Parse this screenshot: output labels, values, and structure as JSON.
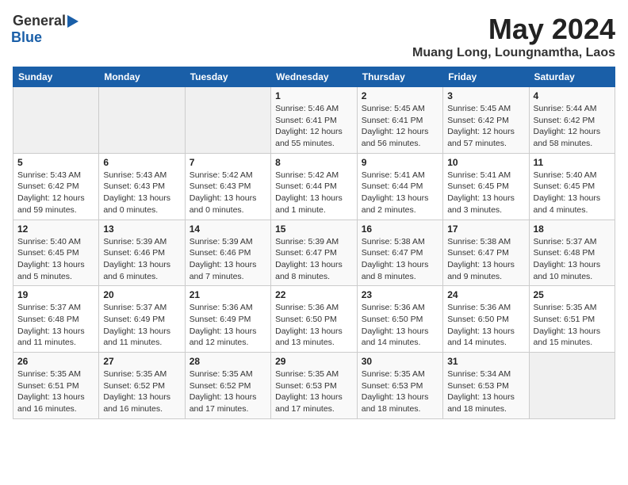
{
  "logo": {
    "general": "General",
    "blue": "Blue"
  },
  "title": "May 2024",
  "location": "Muang Long, Loungnamtha, Laos",
  "days_of_week": [
    "Sunday",
    "Monday",
    "Tuesday",
    "Wednesday",
    "Thursday",
    "Friday",
    "Saturday"
  ],
  "weeks": [
    [
      {
        "day": "",
        "info": ""
      },
      {
        "day": "",
        "info": ""
      },
      {
        "day": "",
        "info": ""
      },
      {
        "day": "1",
        "info": "Sunrise: 5:46 AM\nSunset: 6:41 PM\nDaylight: 12 hours\nand 55 minutes."
      },
      {
        "day": "2",
        "info": "Sunrise: 5:45 AM\nSunset: 6:41 PM\nDaylight: 12 hours\nand 56 minutes."
      },
      {
        "day": "3",
        "info": "Sunrise: 5:45 AM\nSunset: 6:42 PM\nDaylight: 12 hours\nand 57 minutes."
      },
      {
        "day": "4",
        "info": "Sunrise: 5:44 AM\nSunset: 6:42 PM\nDaylight: 12 hours\nand 58 minutes."
      }
    ],
    [
      {
        "day": "5",
        "info": "Sunrise: 5:43 AM\nSunset: 6:42 PM\nDaylight: 12 hours\nand 59 minutes."
      },
      {
        "day": "6",
        "info": "Sunrise: 5:43 AM\nSunset: 6:43 PM\nDaylight: 13 hours\nand 0 minutes."
      },
      {
        "day": "7",
        "info": "Sunrise: 5:42 AM\nSunset: 6:43 PM\nDaylight: 13 hours\nand 0 minutes."
      },
      {
        "day": "8",
        "info": "Sunrise: 5:42 AM\nSunset: 6:44 PM\nDaylight: 13 hours\nand 1 minute."
      },
      {
        "day": "9",
        "info": "Sunrise: 5:41 AM\nSunset: 6:44 PM\nDaylight: 13 hours\nand 2 minutes."
      },
      {
        "day": "10",
        "info": "Sunrise: 5:41 AM\nSunset: 6:45 PM\nDaylight: 13 hours\nand 3 minutes."
      },
      {
        "day": "11",
        "info": "Sunrise: 5:40 AM\nSunset: 6:45 PM\nDaylight: 13 hours\nand 4 minutes."
      }
    ],
    [
      {
        "day": "12",
        "info": "Sunrise: 5:40 AM\nSunset: 6:45 PM\nDaylight: 13 hours\nand 5 minutes."
      },
      {
        "day": "13",
        "info": "Sunrise: 5:39 AM\nSunset: 6:46 PM\nDaylight: 13 hours\nand 6 minutes."
      },
      {
        "day": "14",
        "info": "Sunrise: 5:39 AM\nSunset: 6:46 PM\nDaylight: 13 hours\nand 7 minutes."
      },
      {
        "day": "15",
        "info": "Sunrise: 5:39 AM\nSunset: 6:47 PM\nDaylight: 13 hours\nand 8 minutes."
      },
      {
        "day": "16",
        "info": "Sunrise: 5:38 AM\nSunset: 6:47 PM\nDaylight: 13 hours\nand 8 minutes."
      },
      {
        "day": "17",
        "info": "Sunrise: 5:38 AM\nSunset: 6:47 PM\nDaylight: 13 hours\nand 9 minutes."
      },
      {
        "day": "18",
        "info": "Sunrise: 5:37 AM\nSunset: 6:48 PM\nDaylight: 13 hours\nand 10 minutes."
      }
    ],
    [
      {
        "day": "19",
        "info": "Sunrise: 5:37 AM\nSunset: 6:48 PM\nDaylight: 13 hours\nand 11 minutes."
      },
      {
        "day": "20",
        "info": "Sunrise: 5:37 AM\nSunset: 6:49 PM\nDaylight: 13 hours\nand 11 minutes."
      },
      {
        "day": "21",
        "info": "Sunrise: 5:36 AM\nSunset: 6:49 PM\nDaylight: 13 hours\nand 12 minutes."
      },
      {
        "day": "22",
        "info": "Sunrise: 5:36 AM\nSunset: 6:50 PM\nDaylight: 13 hours\nand 13 minutes."
      },
      {
        "day": "23",
        "info": "Sunrise: 5:36 AM\nSunset: 6:50 PM\nDaylight: 13 hours\nand 14 minutes."
      },
      {
        "day": "24",
        "info": "Sunrise: 5:36 AM\nSunset: 6:50 PM\nDaylight: 13 hours\nand 14 minutes."
      },
      {
        "day": "25",
        "info": "Sunrise: 5:35 AM\nSunset: 6:51 PM\nDaylight: 13 hours\nand 15 minutes."
      }
    ],
    [
      {
        "day": "26",
        "info": "Sunrise: 5:35 AM\nSunset: 6:51 PM\nDaylight: 13 hours\nand 16 minutes."
      },
      {
        "day": "27",
        "info": "Sunrise: 5:35 AM\nSunset: 6:52 PM\nDaylight: 13 hours\nand 16 minutes."
      },
      {
        "day": "28",
        "info": "Sunrise: 5:35 AM\nSunset: 6:52 PM\nDaylight: 13 hours\nand 17 minutes."
      },
      {
        "day": "29",
        "info": "Sunrise: 5:35 AM\nSunset: 6:53 PM\nDaylight: 13 hours\nand 17 minutes."
      },
      {
        "day": "30",
        "info": "Sunrise: 5:35 AM\nSunset: 6:53 PM\nDaylight: 13 hours\nand 18 minutes."
      },
      {
        "day": "31",
        "info": "Sunrise: 5:34 AM\nSunset: 6:53 PM\nDaylight: 13 hours\nand 18 minutes."
      },
      {
        "day": "",
        "info": ""
      }
    ]
  ]
}
